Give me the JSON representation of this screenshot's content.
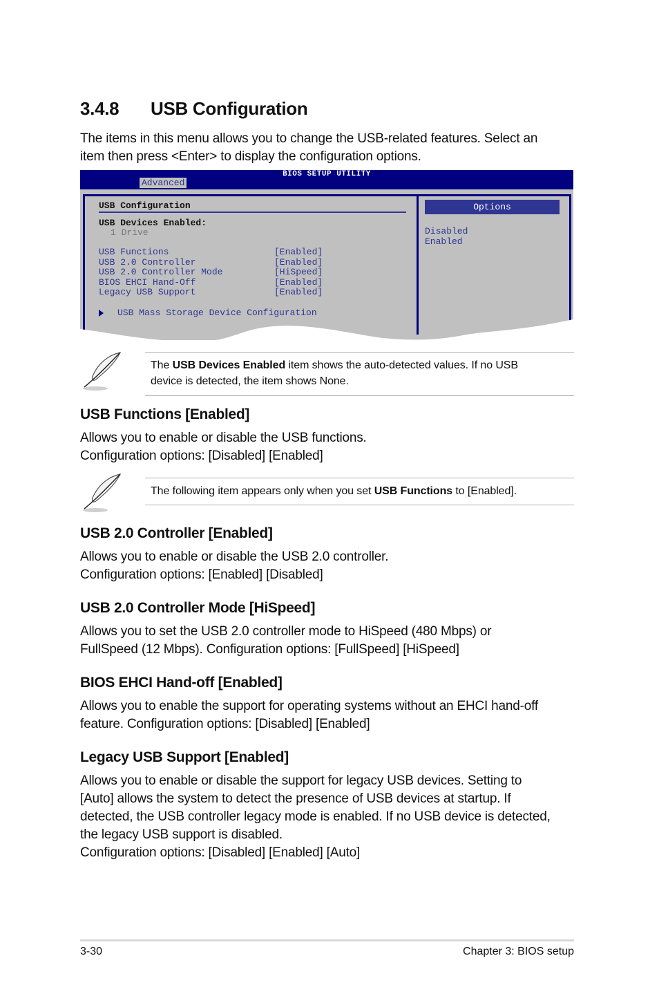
{
  "section": {
    "number": "3.4.8",
    "title": "USB Configuration",
    "intro_lines": [
      "The items in this menu allows you to change the USB-related features. Select an",
      "item then press <Enter> to display the configuration options."
    ]
  },
  "bios": {
    "title": "BIOS SETUP UTILITY",
    "active_tab": "Advanced",
    "panel_title": "USB Configuration",
    "devices_label": "USB Devices Enabled:",
    "devices_value": "1 Drive",
    "items": [
      {
        "label": "USB Functions",
        "value": "[Enabled]"
      },
      {
        "label": "USB 2.0 Controller",
        "value": "[Enabled]"
      },
      {
        "label": "USB 2.0 Controller Mode",
        "value": "[HiSpeed]"
      },
      {
        "label": "BIOS EHCI Hand-Off",
        "value": "[Enabled]"
      },
      {
        "label": "Legacy USB Support",
        "value": "[Enabled]"
      }
    ],
    "submenu": "USB Mass Storage Device Configuration",
    "options_title": "Options",
    "options": [
      "Disabled",
      "Enabled"
    ],
    "colors": {
      "header_bg": "#000080",
      "panel_bg": "#c0c0c0",
      "text_blue": "#2e3592"
    }
  },
  "notes": [
    {
      "icon": "feather-icon",
      "pre": "The ",
      "bold": "USB Devices Enabled",
      "post": " item shows the auto-detected values. If no USB",
      "line2": "device is detected, the item shows None."
    },
    {
      "icon": "feather-icon",
      "pre": "The following item appears only when you set ",
      "bold": "USB Functions",
      "post": " to [Enabled]."
    }
  ],
  "items": [
    {
      "heading": "USB Functions [Enabled]",
      "lines": [
        "Allows you to enable or disable the USB functions.",
        "Configuration options: [Disabled] [Enabled]"
      ]
    },
    {
      "heading": "USB 2.0 Controller [Enabled]",
      "lines": [
        "Allows you to enable or disable the USB 2.0 controller.",
        "Configuration options: [Enabled] [Disabled]"
      ]
    },
    {
      "heading": "USB 2.0 Controller Mode [HiSpeed]",
      "lines": [
        "Allows you to set the USB 2.0 controller mode to HiSpeed (480 Mbps) or",
        "FullSpeed (12 Mbps). Configuration options: [FullSpeed] [HiSpeed]"
      ]
    },
    {
      "heading": "BIOS EHCI Hand-off [Enabled]",
      "lines": [
        "Allows you to enable the support for operating systems without an EHCI hand-off",
        "feature. Configuration options: [Disabled] [Enabled]"
      ]
    },
    {
      "heading": "Legacy USB Support [Enabled]",
      "lines": [
        "Allows you to enable or disable the support for legacy USB devices. Setting to",
        "[Auto] allows the system to detect the presence of USB devices at startup. If",
        "detected, the USB controller legacy mode is enabled. If no USB device is detected,",
        "the legacy USB support is disabled.",
        "Configuration options: [Disabled] [Enabled] [Auto]"
      ]
    }
  ],
  "footer": {
    "page": "3-30",
    "chapter": "Chapter 3: BIOS setup"
  }
}
